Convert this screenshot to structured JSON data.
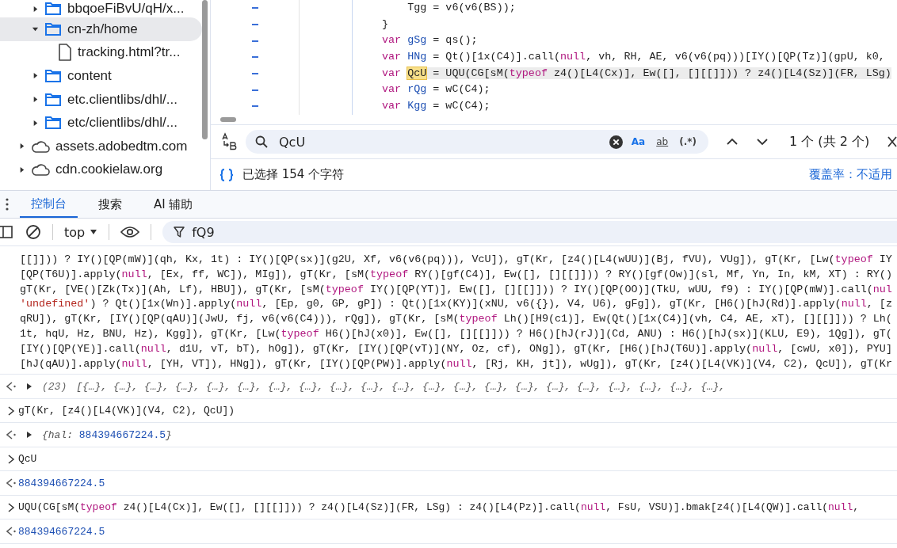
{
  "tree": [
    {
      "kind": "group",
      "children": [
        {
          "kind": "folder",
          "label": "bbqoeFiBvU/qH/x...",
          "expanded": false,
          "selected": false
        },
        {
          "kind": "folder",
          "label": "cn-zh/home",
          "expanded": true,
          "selected": true,
          "children": [
            {
              "kind": "file",
              "label": "tracking.html?tr...",
              "selected": false
            }
          ]
        },
        {
          "kind": "folder",
          "label": "content",
          "expanded": false,
          "selected": false
        },
        {
          "kind": "folder",
          "label": "etc.clientlibs/dhl/...",
          "expanded": false,
          "selected": false
        },
        {
          "kind": "folder",
          "label": "etc/clientlibs/dhl/...",
          "expanded": false,
          "selected": false
        }
      ]
    },
    {
      "kind": "domain",
      "label": "assets.adobedtm.com",
      "expanded": false,
      "selected": false
    },
    {
      "kind": "domain",
      "label": "cdn.cookielaw.org",
      "expanded": false,
      "selected": false
    }
  ],
  "editor": {
    "lines": [
      [
        {
          "kind": "plain",
          "text": "    Tgg = v6(v6(BS));"
        }
      ],
      [
        {
          "kind": "plain",
          "text": "}"
        }
      ],
      [
        {
          "kind": "kw",
          "text": "var "
        },
        {
          "kind": "def",
          "text": "gSg"
        },
        {
          "kind": "plain",
          "text": " = qs();"
        }
      ],
      [
        {
          "kind": "kw",
          "text": "var "
        },
        {
          "kind": "def",
          "text": "HNg"
        },
        {
          "kind": "plain",
          "text": " = Qt()[1x(C4)].call("
        },
        {
          "kind": "kw",
          "text": "null"
        },
        {
          "kind": "plain",
          "text": ", vh, RH, AE, v6(v6(pq)))[IY()[QP(Tz)](gpU, k0,"
        }
      ],
      [
        {
          "kind": "kw",
          "text": "var "
        },
        {
          "kind": "match",
          "text": "QcU"
        },
        {
          "kind": "sel",
          "text": " = UQU(CG[sM("
        },
        {
          "kind": "selkw",
          "text": "typeof"
        },
        {
          "kind": "sel",
          "text": " z4()[L4(Cx)], Ew([], [][[]])) ? z4()[L4(Sz)](FR, LSg)"
        }
      ],
      [
        {
          "kind": "kw",
          "text": "var "
        },
        {
          "kind": "def",
          "text": "rQg"
        },
        {
          "kind": "plain",
          "text": " = wC(C4);"
        }
      ],
      [
        {
          "kind": "kw",
          "text": "var "
        },
        {
          "kind": "def",
          "text": "Kgg"
        },
        {
          "kind": "plain",
          "text": " = wC(C4);"
        }
      ]
    ]
  },
  "search": {
    "value": "QcU",
    "options": [
      {
        "kind": "case",
        "label": "Aa",
        "on": true
      },
      {
        "kind": "word",
        "label": "ab",
        "on": false
      },
      {
        "kind": "regex",
        "label": "(.*)",
        "on": false
      }
    ],
    "count": "1 个 (共 2 个)"
  },
  "status_bar": {
    "selection": "已选择 154 个字符",
    "coverage": "覆盖率：不适用"
  },
  "drawer_tabs": [
    {
      "label": "控制台",
      "selected": true
    },
    {
      "label": "搜索",
      "selected": false
    },
    {
      "label": "AI 辅助",
      "selected": false
    }
  ],
  "console_toolbar": {
    "context": "top",
    "filter": "fQ9"
  },
  "console": {
    "block": [
      [
        {
          "kind": "plain",
          "text": "[[]])) ? IY()[QP(mW)](qh, Kx, 1t) : IY()[QP(sx)](g2U, Xf, v6(v6(pq))), VcU]), gT(Kr, [z4()[L4(wUU)](Bj, fVU), VUg]), gT(Kr, [Lw("
        },
        {
          "kind": "kw",
          "text": "typeof"
        },
        {
          "kind": "plain",
          "text": " IY"
        }
      ],
      [
        {
          "kind": "plain",
          "text": "[QP(T6U)].apply("
        },
        {
          "kind": "kw",
          "text": "null"
        },
        {
          "kind": "plain",
          "text": ", [Ex, ff, WC]), MIg]), gT(Kr, [sM("
        },
        {
          "kind": "kw",
          "text": "typeof"
        },
        {
          "kind": "plain",
          "text": " RY()[gf(C4)], Ew([], [][[]])) ? RY()[gf(Ow)](sl, Mf, Yn, In, kM, XT) : RY()"
        }
      ],
      [
        {
          "kind": "plain",
          "text": "gT(Kr, [VE()[Zk(Tx)](Ah, Lf), HBU]), gT(Kr, [sM("
        },
        {
          "kind": "kw",
          "text": "typeof"
        },
        {
          "kind": "plain",
          "text": " IY()[QP(YT)], Ew([], [][[]])) ? IY()[QP(OO)](TkU, wUU, f9) : IY()[QP(mW)].call("
        },
        {
          "kind": "kw",
          "text": "nul"
        }
      ],
      [
        {
          "kind": "str",
          "text": "'undefined'"
        },
        {
          "kind": "plain",
          "text": ") ? Qt()[1x(Wn)].apply("
        },
        {
          "kind": "kw",
          "text": "null"
        },
        {
          "kind": "plain",
          "text": ", [Ep, g0, GP, gP]) : Qt()[1x(KY)](xNU, v6({}), V4, U6), gFg]), gT(Kr, [H6()[hJ(Rd)].apply("
        },
        {
          "kind": "kw",
          "text": "null"
        },
        {
          "kind": "plain",
          "text": ", [z"
        }
      ],
      [
        {
          "kind": "plain",
          "text": "qRU]), gT(Kr, [IY()[QP(qAU)](JwU, fj, v6(v6(C4))), rQg]), gT(Kr, [sM("
        },
        {
          "kind": "kw",
          "text": "typeof"
        },
        {
          "kind": "plain",
          "text": " Lh()[H9(c1)], Ew(Qt()[1x(C4)](vh, C4, AE, xT), [][[]])) ? Lh("
        }
      ],
      [
        {
          "kind": "plain",
          "text": "1t, hqU, Hz, BNU, Hz), Kgg]), gT(Kr, [Lw("
        },
        {
          "kind": "kw",
          "text": "typeof"
        },
        {
          "kind": "plain",
          "text": " H6()[hJ(x0)], Ew([], [][[]])) ? H6()[hJ(rJ)](Cd, ANU) : H6()[hJ(sx)](KLU, E9), 1Qg]), gT("
        }
      ],
      [
        {
          "kind": "plain",
          "text": "[IY()[QP(YE)].call("
        },
        {
          "kind": "kw",
          "text": "null"
        },
        {
          "kind": "plain",
          "text": ", d1U, vT, bT), hOg]), gT(Kr, [IY()[QP(vT)](NY, Oz, cf), ONg]), gT(Kr, [H6()[hJ(T6U)].apply("
        },
        {
          "kind": "kw",
          "text": "null"
        },
        {
          "kind": "plain",
          "text": ", [cwU, x0]), PYU]"
        }
      ],
      [
        {
          "kind": "plain",
          "text": "[hJ(qAU)].apply("
        },
        {
          "kind": "kw",
          "text": "null"
        },
        {
          "kind": "plain",
          "text": ", [YH, VT]), HNg]), gT(Kr, [IY()[QP(PW)].apply("
        },
        {
          "kind": "kw",
          "text": "null"
        },
        {
          "kind": "plain",
          "text": ", [Rj, KH, jt]), wUg]), gT(Kr, [z4()[L4(VK)](V4, C2), QcU]), gT(Kr"
        }
      ]
    ],
    "entries": [
      {
        "kind": "output",
        "expandable": true,
        "segments": [
          {
            "kind": "count",
            "text": "(23)"
          },
          {
            "kind": "italic",
            "text": "[{…}, {…}, {…}, {…}, {…}, {…}, {…}, {…}, {…}, {…}, {…}, {…}, {…}, {…}, {…}, {…}, {…}, {…}, {…}, {…}, {…},"
          }
        ]
      },
      {
        "kind": "input",
        "expandable": false,
        "segments": [
          {
            "kind": "plain",
            "text": "gT(Kr, [z4()[L4(VK)](V4, C2), QcU])"
          }
        ]
      },
      {
        "kind": "output",
        "expandable": true,
        "segments": [
          {
            "kind": "key",
            "text": "{hal: "
          },
          {
            "kind": "inum",
            "text": "884394667224.5"
          },
          {
            "kind": "key",
            "text": "}"
          }
        ]
      },
      {
        "kind": "input",
        "expandable": false,
        "segments": [
          {
            "kind": "plain",
            "text": "QcU"
          }
        ]
      },
      {
        "kind": "output",
        "expandable": false,
        "segments": [
          {
            "kind": "num",
            "text": "884394667224.5"
          }
        ]
      },
      {
        "kind": "input",
        "expandable": false,
        "segments": [
          {
            "kind": "plain",
            "text": "UQU(CG[sM("
          },
          {
            "kind": "kw",
            "text": "typeof"
          },
          {
            "kind": "plain",
            "text": " z4()[L4(Cx)], Ew([], [][[]])) ? z4()[L4(Sz)](FR, LSg) : z4()[L4(Pz)].call("
          },
          {
            "kind": "kw",
            "text": "null"
          },
          {
            "kind": "plain",
            "text": ", FsU, VSU)].bmak[z4()[L4(QW)].call("
          },
          {
            "kind": "kw",
            "text": "null"
          },
          {
            "kind": "plain",
            "text": ","
          }
        ]
      },
      {
        "kind": "output",
        "expandable": false,
        "segments": [
          {
            "kind": "num",
            "text": "884394667224.5"
          }
        ]
      }
    ]
  }
}
